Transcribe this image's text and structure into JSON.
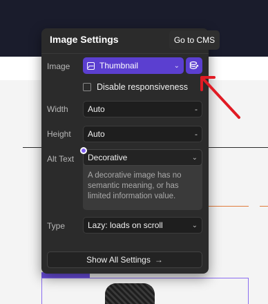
{
  "panel": {
    "title": "Image Settings",
    "image": {
      "label": "Image",
      "value": "Thumbnail",
      "icon": "image-icon",
      "cms_icon": "database-link-icon"
    },
    "responsive": {
      "label": "Disable responsiveness",
      "checked": false
    },
    "width": {
      "label": "Width",
      "value": "Auto",
      "suffix": "-"
    },
    "height": {
      "label": "Height",
      "value": "Auto",
      "suffix": "-"
    },
    "alt_text": {
      "label": "Alt Text",
      "value": "Decorative",
      "description": "A decorative image has no semantic meaning, or has limited information value."
    },
    "type": {
      "label": "Type",
      "value": "Lazy: loads on scroll"
    },
    "show_all": {
      "label": "Show All Settings",
      "arrow": "→"
    }
  },
  "tooltip": {
    "text": "Go to CMS"
  },
  "colors": {
    "panel_bg": "#2b2b2b",
    "accent": "#5b3fd0",
    "annotation": "#e01b24"
  }
}
